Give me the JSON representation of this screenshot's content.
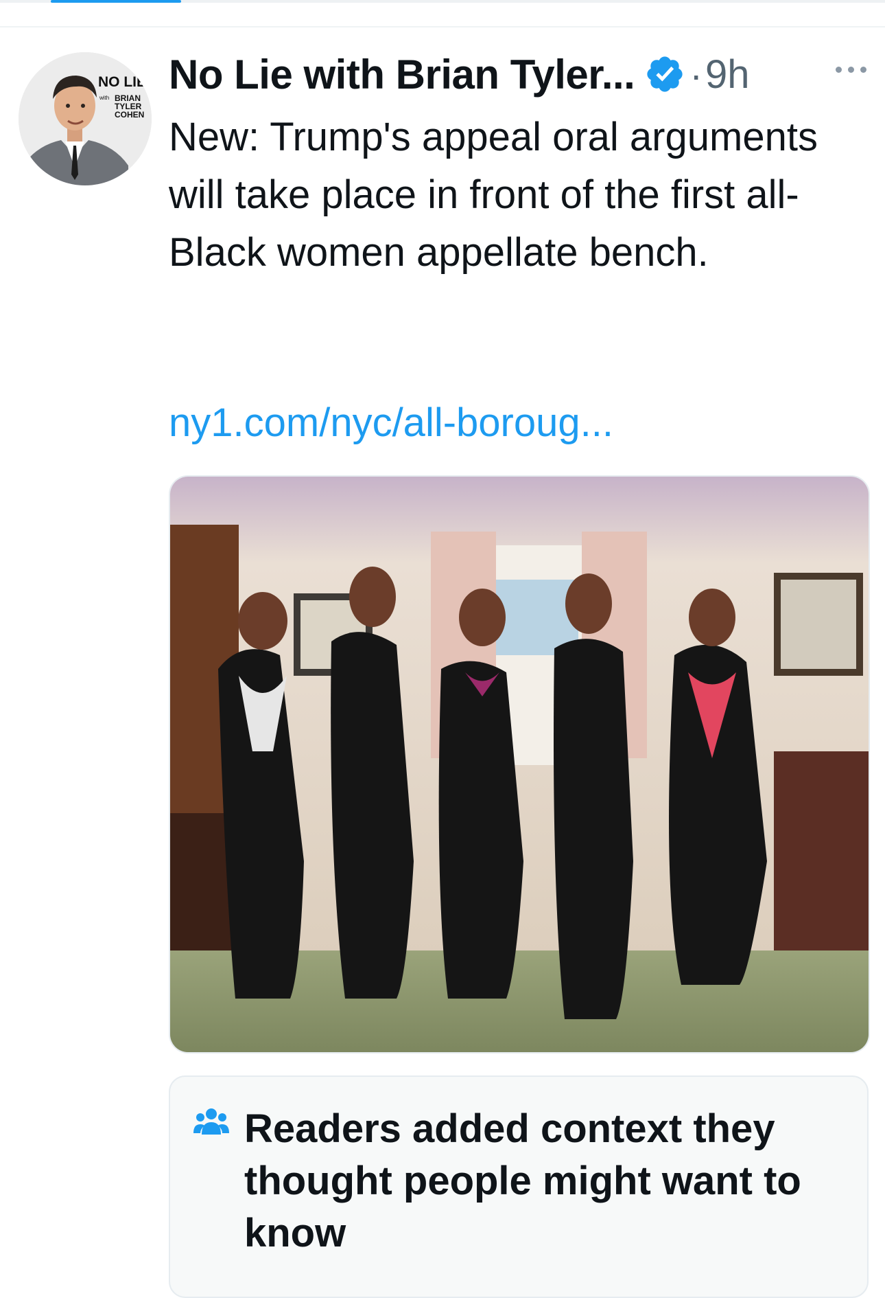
{
  "tweet": {
    "author": "No Lie with Brian Tyler...",
    "timestamp": "9h",
    "separator": "·",
    "text": "New: Trump's appeal oral arguments will take place in front of the first all-Black women appellate bench.",
    "link": "ny1.com/nyc/all-boroug...",
    "avatar_logo": {
      "line1": "NO LIE",
      "line2": "with",
      "line3": "BRIAN",
      "line4": "TYLER",
      "line5": "COHEN"
    }
  },
  "community_note": {
    "title": "Readers added context they thought people might want to know"
  },
  "icons": [
    "verified-badge-icon",
    "more-options-icon",
    "readers-group-icon"
  ],
  "colors": {
    "accent": "#1d9bf0",
    "text_primary": "#0f1419",
    "text_secondary": "#536471",
    "note_background": "#f7f9f9"
  }
}
